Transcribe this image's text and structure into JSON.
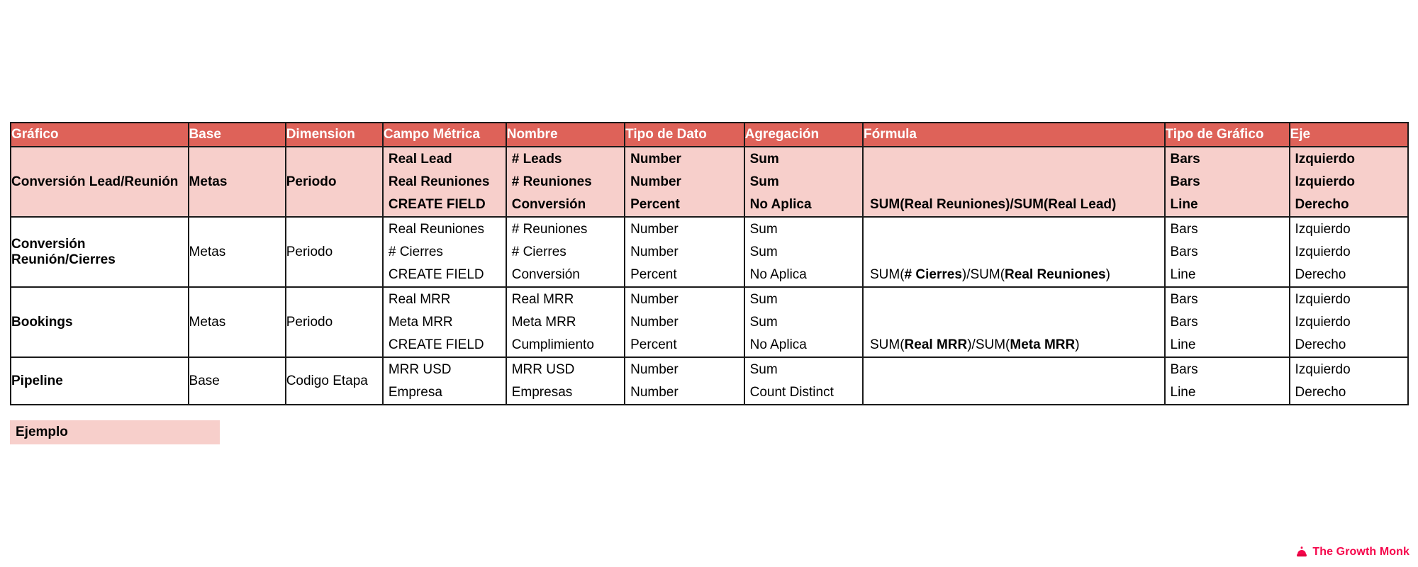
{
  "table": {
    "columns": [
      "Gráfico",
      "Base",
      "Dimension",
      "Campo Métrica",
      "Nombre",
      "Tipo de Dato",
      "Agregación",
      "Fórmula",
      "Tipo de Gráfico",
      "Eje"
    ],
    "rows": [
      {
        "grafico": "Conversión Lead/Reunión",
        "base": "Metas",
        "dimension": "Periodo",
        "highlighted": true,
        "campo_metrica": [
          "Real Lead",
          "Real Reuniones",
          "CREATE FIELD"
        ],
        "nombre": [
          "# Leads",
          "# Reuniones",
          "Conversión"
        ],
        "tipo_de_dato": [
          "Number",
          "Number",
          "Percent"
        ],
        "agregacion": [
          "Sum",
          "Sum",
          "No Aplica"
        ],
        "formula": [
          "",
          "",
          "SUM(Real Reuniones)/SUM(Real Lead)"
        ],
        "formula_parts": [
          [],
          [],
          [
            {
              "t": "SUM(",
              "b": false
            },
            {
              "t": "Real Reuniones",
              "b": true
            },
            {
              "t": ")/SUM(",
              "b": false
            },
            {
              "t": "Real Lead",
              "b": true
            },
            {
              "t": ")",
              "b": false
            }
          ]
        ],
        "tipo_de_grafico": [
          "Bars",
          "Bars",
          "Line"
        ],
        "eje": [
          "Izquierdo",
          "Izquierdo",
          "Derecho"
        ]
      },
      {
        "grafico": "Conversión Reunión/Cierres",
        "base": "Metas",
        "dimension": "Periodo",
        "highlighted": false,
        "campo_metrica": [
          "Real Reuniones",
          "# Cierres",
          "CREATE FIELD"
        ],
        "nombre": [
          "# Reuniones",
          "# Cierres",
          "Conversión"
        ],
        "tipo_de_dato": [
          "Number",
          "Number",
          "Percent"
        ],
        "agregacion": [
          "Sum",
          "Sum",
          "No Aplica"
        ],
        "formula": [
          "",
          "",
          "SUM(# Cierres)/SUM(Real Reuniones)"
        ],
        "formula_parts": [
          [],
          [],
          [
            {
              "t": "SUM(",
              "b": false
            },
            {
              "t": "# Cierres",
              "b": true
            },
            {
              "t": ")/SUM(",
              "b": false
            },
            {
              "t": "Real Reuniones",
              "b": true
            },
            {
              "t": ")",
              "b": false
            }
          ]
        ],
        "tipo_de_grafico": [
          "Bars",
          "Bars",
          "Line"
        ],
        "eje": [
          "Izquierdo",
          "Izquierdo",
          "Derecho"
        ]
      },
      {
        "grafico": "Bookings",
        "base": "Metas",
        "dimension": "Periodo",
        "highlighted": false,
        "campo_metrica": [
          "Real MRR",
          "Meta MRR",
          "CREATE FIELD"
        ],
        "nombre": [
          "Real MRR",
          "Meta MRR",
          "Cumplimiento"
        ],
        "tipo_de_dato": [
          "Number",
          "Number",
          "Percent"
        ],
        "agregacion": [
          "Sum",
          "Sum",
          "No Aplica"
        ],
        "formula": [
          "",
          "",
          "SUM(Real MRR)/SUM(Meta MRR)"
        ],
        "formula_parts": [
          [],
          [],
          [
            {
              "t": "SUM(",
              "b": false
            },
            {
              "t": "Real MRR",
              "b": true
            },
            {
              "t": ")/SUM(",
              "b": false
            },
            {
              "t": "Meta MRR",
              "b": true
            },
            {
              "t": ")",
              "b": false
            }
          ]
        ],
        "tipo_de_grafico": [
          "Bars",
          "Bars",
          "Line"
        ],
        "eje": [
          "Izquierdo",
          "Izquierdo",
          "Derecho"
        ]
      },
      {
        "grafico": "Pipeline",
        "base": "Base",
        "dimension": "Codigo Etapa",
        "highlighted": false,
        "campo_metrica": [
          "MRR USD",
          "Empresa"
        ],
        "nombre": [
          "MRR USD",
          "Empresas"
        ],
        "tipo_de_dato": [
          "Number",
          "Number"
        ],
        "agregacion": [
          "Sum",
          "Count Distinct"
        ],
        "formula": [
          "",
          ""
        ],
        "formula_parts": [
          [],
          []
        ],
        "tipo_de_grafico": [
          "Bars",
          "Line"
        ],
        "eje": [
          "Izquierdo",
          "Derecho"
        ]
      }
    ]
  },
  "legend": {
    "label": "Ejemplo"
  },
  "watermark": {
    "text": "The Growth Monk",
    "icon": "beanie-hat-icon",
    "color": "#f5064b"
  },
  "colors": {
    "header_background": "#de6259",
    "header_text": "#ffffff",
    "highlight_row": "#f7cfcb",
    "border": "#1a1a1a",
    "body_text": "#000000",
    "page_background": "#ffffff"
  }
}
